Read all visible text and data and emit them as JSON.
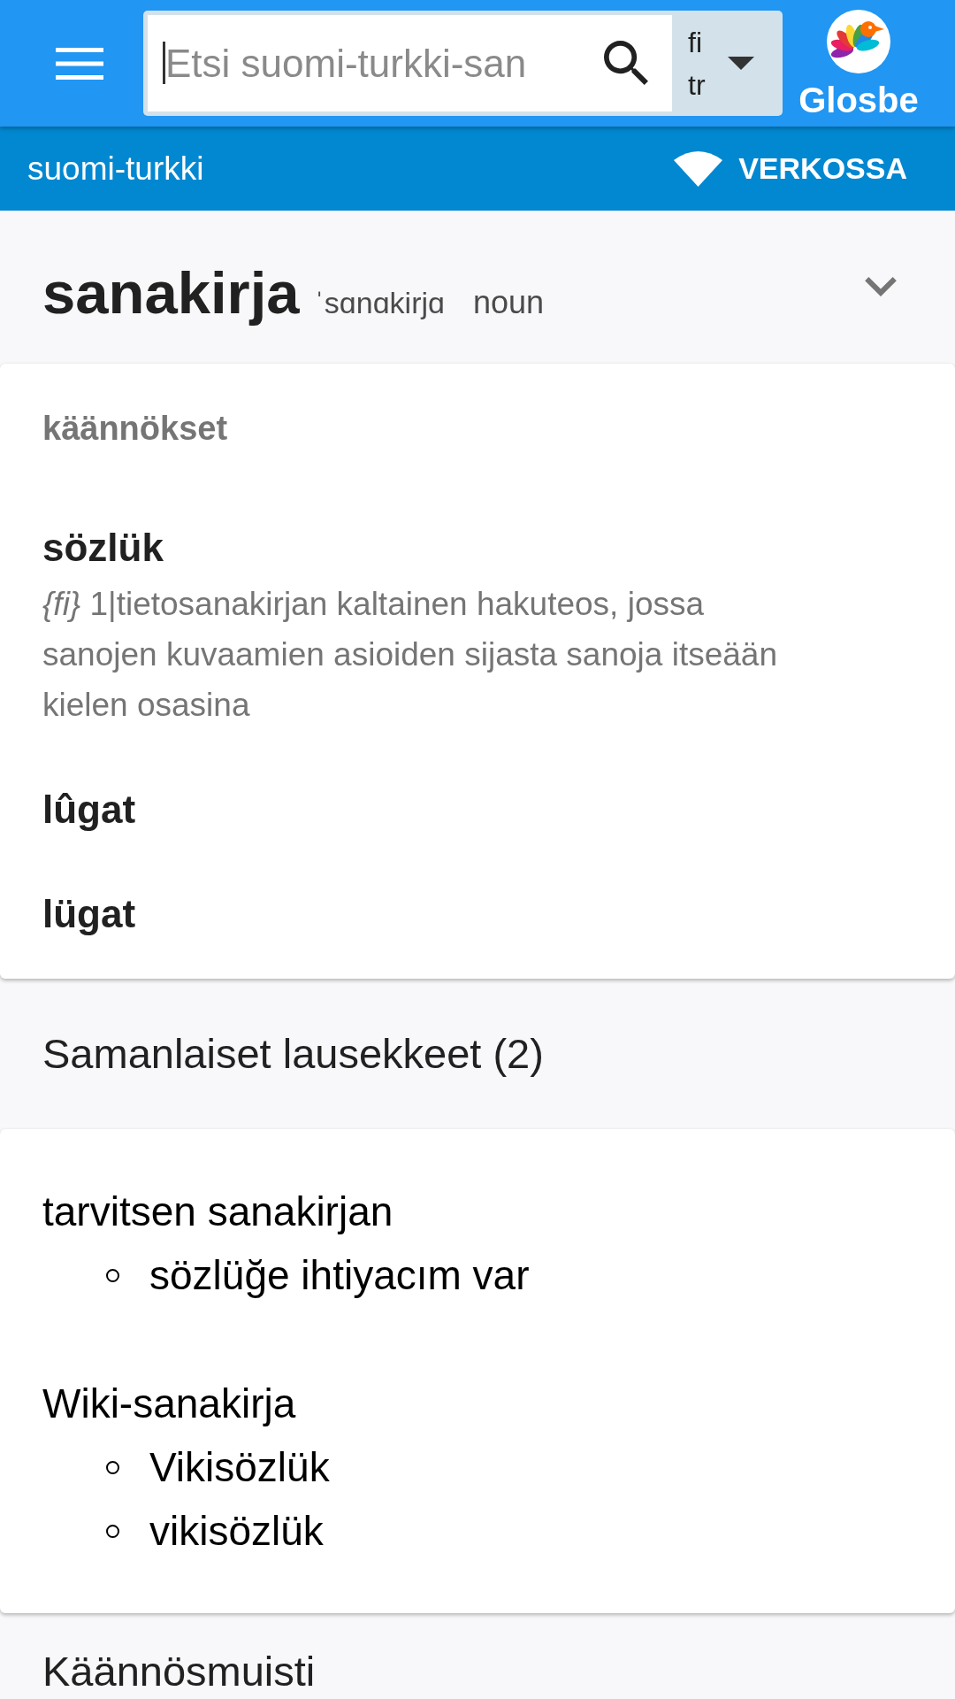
{
  "top_bar": {
    "search": {
      "placeholder": "Etsi suomi-turkki-san"
    },
    "language_picker": {
      "source": "fi",
      "target": "tr"
    },
    "logo": "Glosbe"
  },
  "sub_bar": {
    "dictionary": "suomi-turkki",
    "status": "VERKOSSA"
  },
  "entry": {
    "word": "sanakirja",
    "pronunciation": "ˈsɑnɑkirjɑ",
    "part_of_speech": "noun"
  },
  "translations": {
    "heading": "käännökset",
    "items": [
      {
        "term": "sözlük",
        "definition": "*{fi}* 1|tietosanakirjan kaltainen hakuteos, jossa sanojen kuvaamien asioiden sijasta sanoja itseään kielen osasina"
      },
      {
        "term": "lûgat"
      },
      {
        "term": "lügat"
      }
    ]
  },
  "similar_phrases": {
    "heading": "Samanlaiset lausekkeet (2)",
    "items": [
      {
        "phrase": "tarvitsen sanakirjan",
        "translations": [
          "sözlüğe ihtiyacım var"
        ]
      },
      {
        "phrase": "Wiki-sanakirja",
        "translations": [
          "Vikisözlük",
          "vikisözlük"
        ]
      }
    ]
  },
  "translation_memory": {
    "heading": "Käännösmuisti"
  }
}
